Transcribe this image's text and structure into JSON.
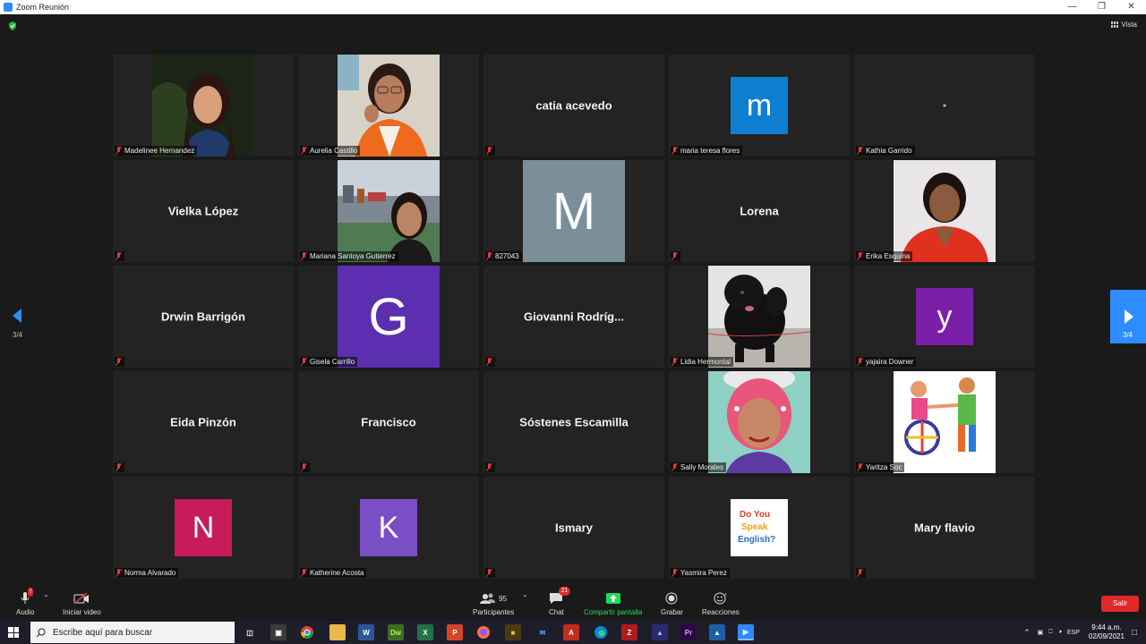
{
  "window": {
    "title": "Zoom Reunión"
  },
  "meeting": {
    "view_label": "Vista",
    "page_indicator": "3/4",
    "tiles": [
      {
        "name": "Madelinee Hernandez",
        "type": "photo",
        "photo": "woman-dark-hair-night"
      },
      {
        "name": "Aurelia Castillo",
        "type": "photo",
        "photo": "woman-glasses-orange"
      },
      {
        "name": "catia acevedo",
        "type": "text"
      },
      {
        "name": "maria teresa flores",
        "type": "avatar",
        "initial": "m",
        "color": "#0e7fd0"
      },
      {
        "name": "Kathia Garrido",
        "type": "dot"
      },
      {
        "name": "Vielka López",
        "type": "text"
      },
      {
        "name": "Mariana Santoya Gutierrez",
        "type": "photo",
        "photo": "woman-port-background"
      },
      {
        "name": "827043",
        "type": "avatar",
        "initial": "M",
        "color": "#7b8f9b"
      },
      {
        "name": "Lorena",
        "type": "text"
      },
      {
        "name": "Erika Esquina",
        "type": "photo",
        "photo": "woman-red-shirt"
      },
      {
        "name": "Drwin Barrigón",
        "type": "text"
      },
      {
        "name": "Gisela Carrillo",
        "type": "avatar",
        "initial": "G",
        "color": "#5b2fb0"
      },
      {
        "name": "Giovanni  Rodríg...",
        "type": "text"
      },
      {
        "name": "Lidia Hermontal",
        "type": "photo",
        "photo": "black-dog"
      },
      {
        "name": "yajaira Downer",
        "type": "avatar",
        "initial": "y",
        "color": "#7a1fa8"
      },
      {
        "name": "Eida Pinzón",
        "type": "text"
      },
      {
        "name": "Francisco",
        "type": "text"
      },
      {
        "name": "Sóstenes Escamilla",
        "type": "text"
      },
      {
        "name": "Sally Morales",
        "type": "photo",
        "photo": "woman-pink-hair"
      },
      {
        "name": "Yaritza Soc",
        "type": "photo",
        "photo": "inclusion-drawing"
      },
      {
        "name": "Norma Alvarado",
        "type": "avatar",
        "initial": "N",
        "color": "#c81b5a"
      },
      {
        "name": "Katherine Acosta",
        "type": "avatar",
        "initial": "K",
        "color": "#7a4ec4"
      },
      {
        "name": "Ismary",
        "type": "text"
      },
      {
        "name": "Yasmira Perez",
        "type": "photo",
        "photo": "do-you-speak-english"
      },
      {
        "name": "Mary flavio",
        "type": "text"
      }
    ]
  },
  "toolbar": {
    "audio_label": "Audio",
    "video_label": "Iniciar video",
    "participants_label": "Participantes",
    "participants_count": "95",
    "chat_label": "Chat",
    "chat_badge": "21",
    "share_label": "Compartir pantalla",
    "record_label": "Grabar",
    "reactions_label": "Reacciones",
    "leave_label": "Salir"
  },
  "taskbar": {
    "search_placeholder": "Escribe aquí para buscar",
    "language": "ESP",
    "time": "9:44 a.m.",
    "date": "02/09/2021"
  },
  "colors": {
    "zoom_blue": "#2d8cff",
    "leave_red": "#e02828",
    "mute_red": "#e23b3b",
    "share_green": "#23d959"
  }
}
